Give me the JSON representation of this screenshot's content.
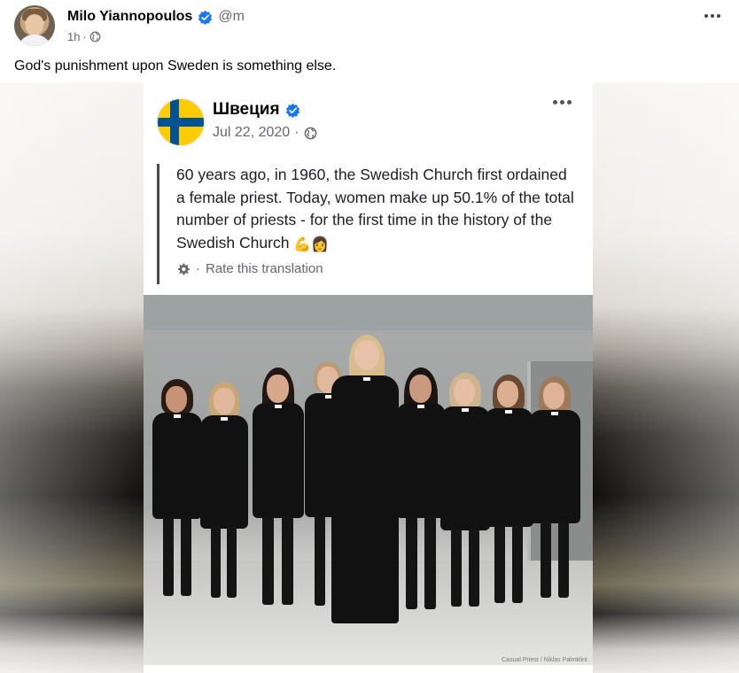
{
  "post": {
    "author": "Milo Yiannopoulos",
    "handle": "@m",
    "time": "1h",
    "separator": "·",
    "text": "God's punishment upon Sweden is something else."
  },
  "icons": {
    "verified": "verified-badge-icon",
    "audience": "globe-icon",
    "more": "more-options-icon",
    "settings": "gear-icon"
  },
  "embedded": {
    "page_name": "Швеция",
    "date": "Jul 22, 2020",
    "separator": "·",
    "text": "60 years ago, in 1960, the Swedish Church first ordained a female priest. Today, women make up 50.1% of the total number of priests - for the first time in the history of the Swedish Church",
    "emojis": "💪👩",
    "translation_dot": "·",
    "translation_label": "Rate this translation",
    "photo_credit": "Casual Priest / Niklas Palmklint"
  },
  "colors": {
    "verified_blue": "#1877f2",
    "flag_blue": "#005293",
    "flag_yellow": "#fecc02",
    "muted_text": "#65676b"
  }
}
